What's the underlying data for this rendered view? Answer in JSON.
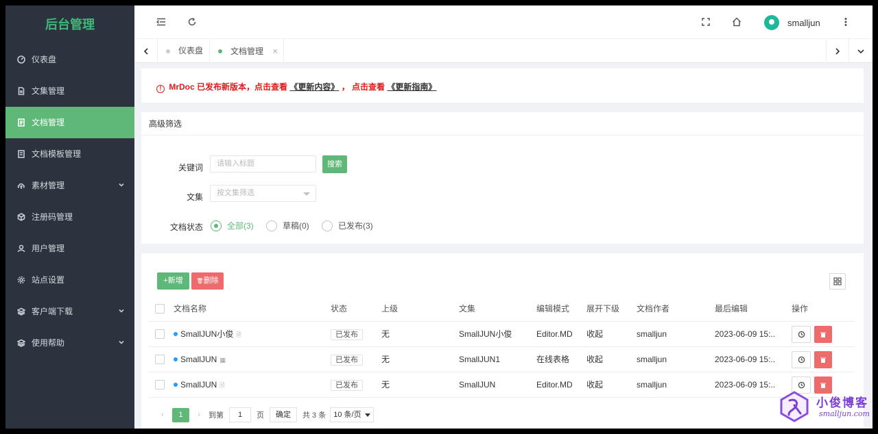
{
  "brand": "后台管理",
  "sidebar": {
    "items": [
      {
        "label": "仪表盘",
        "icon": "dashboard-icon"
      },
      {
        "label": "文集管理",
        "icon": "file-icon"
      },
      {
        "label": "文档管理",
        "icon": "document-icon",
        "active": true
      },
      {
        "label": "文档模板管理",
        "icon": "template-icon"
      },
      {
        "label": "素材管理",
        "icon": "cloud-upload-icon",
        "expandable": true
      },
      {
        "label": "注册码管理",
        "icon": "box-icon"
      },
      {
        "label": "用户管理",
        "icon": "user-icon"
      },
      {
        "label": "站点设置",
        "icon": "gear-icon"
      },
      {
        "label": "客户端下载",
        "icon": "layers-icon",
        "expandable": true
      },
      {
        "label": "使用帮助",
        "icon": "layers-icon",
        "expandable": true
      }
    ]
  },
  "header": {
    "username": "smalljun"
  },
  "tabs": [
    {
      "label": "仪表盘",
      "active": false
    },
    {
      "label": "文档管理",
      "active": true,
      "close": "×"
    }
  ],
  "notice": {
    "icon": "!",
    "text1": "MrDoc 已发布新版本，点击查看",
    "link1": "《更新内容》",
    "text2": "，  点击查看",
    "link2": "《更新指南》"
  },
  "filter": {
    "title": "高级筛选",
    "keyword_label": "关键词",
    "keyword_placeholder": "请输入标题",
    "search_button": "搜索",
    "collection_label": "文集",
    "collection_placeholder": "按文集筛选",
    "status_label": "文档状态",
    "status_options": [
      {
        "label": "全部(3)",
        "checked": true
      },
      {
        "label": "草稿(0)",
        "checked": false
      },
      {
        "label": "已发布(3)",
        "checked": false
      }
    ]
  },
  "table": {
    "add_button": "+新增",
    "delete_button": "删除",
    "delete_icon": "trash-icon",
    "columns": [
      "文档名称",
      "状态",
      "上级",
      "文集",
      "编辑模式",
      "展开下级",
      "文档作者",
      "最后编辑",
      "操作"
    ],
    "rows": [
      {
        "name": "SmallJUN小俊",
        "doc_icon": "🗎",
        "status": "已发布",
        "parent": "无",
        "collection": "SmallJUN小俊",
        "mode": "Editor.MD",
        "expand": "收起",
        "author": "smalljun",
        "edited": "2023-06-09 15:..."
      },
      {
        "name": "SmallJUN",
        "doc_icon": "▦",
        "status": "已发布",
        "parent": "无",
        "collection": "SmallJUN1",
        "mode": "在线表格",
        "expand": "收起",
        "author": "smalljun",
        "edited": "2023-06-09 15:..."
      },
      {
        "name": "SmallJUN",
        "doc_icon": "🗎",
        "status": "已发布",
        "parent": "无",
        "collection": "SmallJUN",
        "mode": "Editor.MD",
        "expand": "收起",
        "author": "smalljun",
        "edited": "2023-06-09 15:..."
      }
    ]
  },
  "pagination": {
    "prev": "‹",
    "current": "1",
    "next": "›",
    "goto_label": "到第",
    "goto_value": "1",
    "page_unit": "页",
    "confirm": "确定",
    "total": "共 3 条",
    "page_size": "10 条/页"
  },
  "watermark": {
    "title": "小俊博客",
    "url": "smalljun.com"
  },
  "colors": {
    "accent": "#5fb878",
    "danger": "#ef6b6b",
    "sidebar_bg": "#2b333e",
    "notice": "#e01b1b"
  }
}
